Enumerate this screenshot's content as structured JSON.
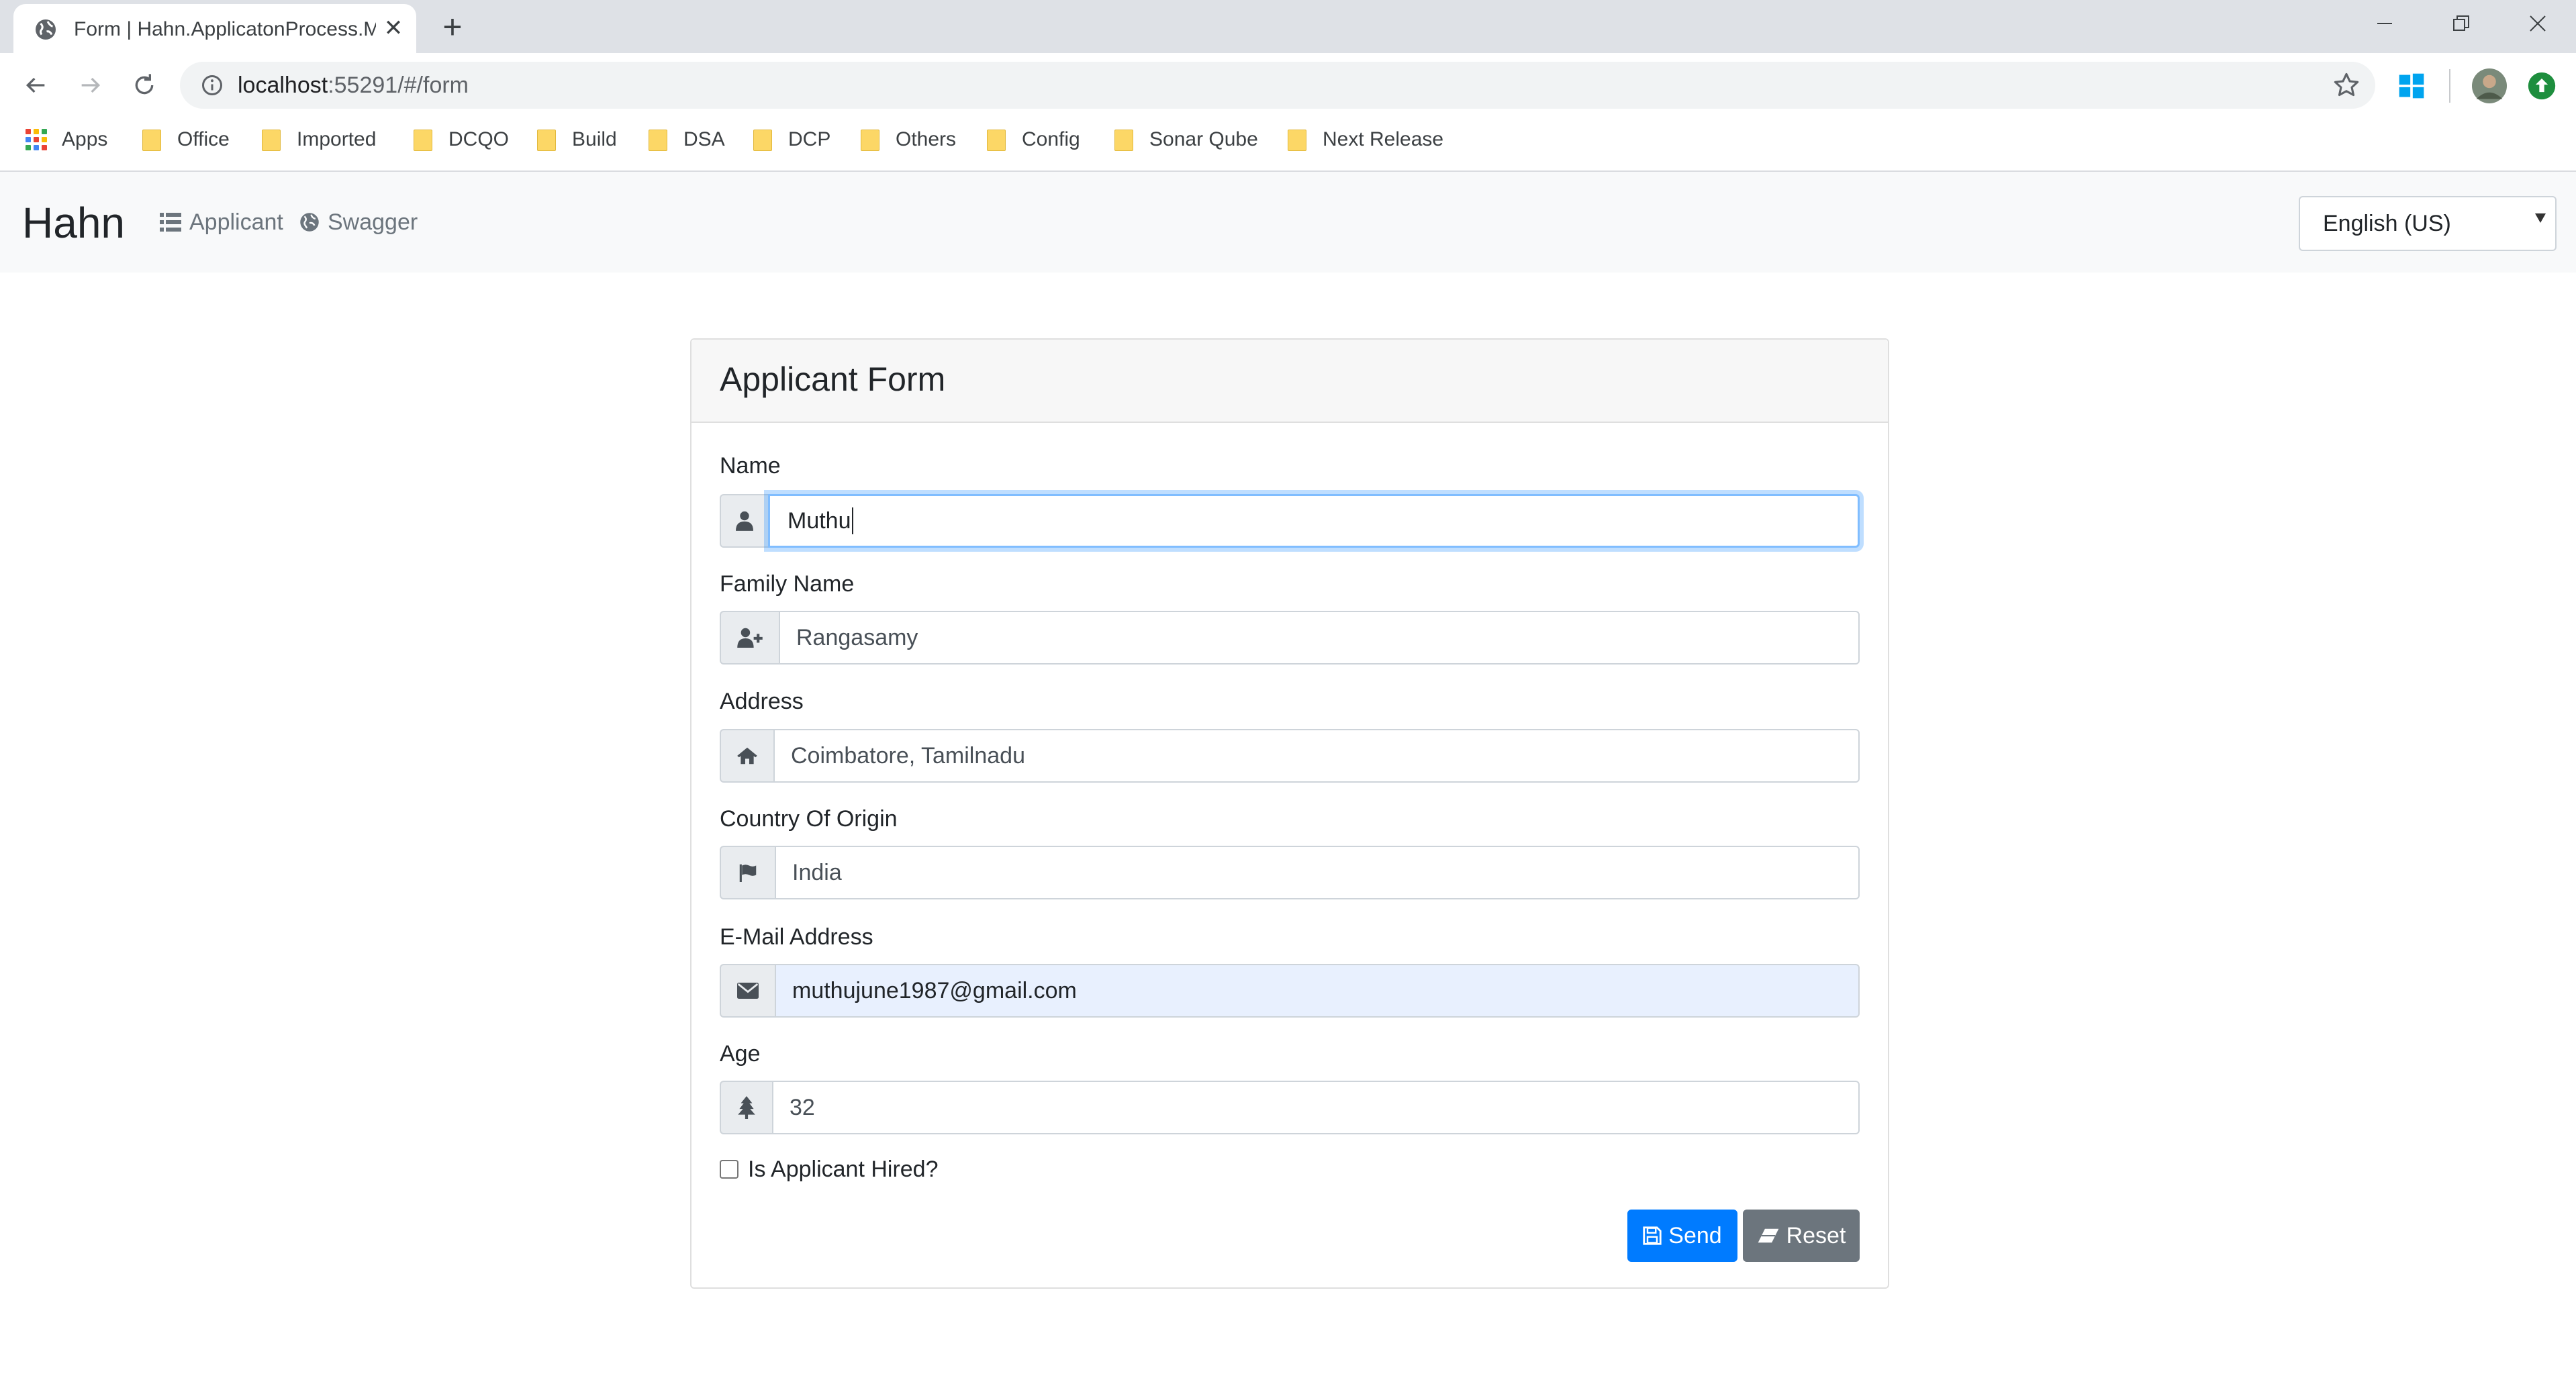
{
  "browser": {
    "tab_title": "Form | Hahn.ApplicatonProcess.M",
    "url_host": "localhost",
    "url_rest": ":55291/#/form",
    "bookmarks": [
      {
        "label": "Apps",
        "icon": "apps-grid-icon"
      },
      {
        "label": "Office",
        "icon": "folder-icon"
      },
      {
        "label": "Imported",
        "icon": "folder-icon"
      },
      {
        "label": "DCQO",
        "icon": "folder-icon"
      },
      {
        "label": "Build",
        "icon": "folder-icon"
      },
      {
        "label": "DSA",
        "icon": "folder-icon"
      },
      {
        "label": "DCP",
        "icon": "folder-icon"
      },
      {
        "label": "Others",
        "icon": "folder-icon"
      },
      {
        "label": "Config",
        "icon": "folder-icon"
      },
      {
        "label": "Sonar Qube",
        "icon": "folder-icon"
      },
      {
        "label": "Next Release",
        "icon": "folder-icon"
      }
    ]
  },
  "navbar": {
    "brand": "Hahn",
    "links": [
      {
        "label": "Applicant",
        "icon": "list-icon"
      },
      {
        "label": "Swagger",
        "icon": "globe-icon"
      }
    ],
    "language": "English (US)"
  },
  "form": {
    "title": "Applicant Form",
    "fields": [
      {
        "label": "Name",
        "value": "Muthu",
        "icon": "user-icon",
        "state": "focused"
      },
      {
        "label": "Family Name",
        "value": "Rangasamy",
        "icon": "user-plus-icon",
        "state": "normal"
      },
      {
        "label": "Address",
        "value": "Coimbatore, Tamilnadu",
        "icon": "home-icon",
        "state": "normal"
      },
      {
        "label": "Country Of Origin",
        "value": "India",
        "icon": "flag-icon",
        "state": "normal"
      },
      {
        "label": "E-Mail Address",
        "value": "muthujune1987@gmail.com",
        "icon": "envelope-icon",
        "state": "autofilled"
      },
      {
        "label": "Age",
        "value": "32",
        "icon": "tree-icon",
        "state": "normal"
      }
    ],
    "hired_label": "Is Applicant Hired?",
    "hired_checked": false,
    "send_label": "Send",
    "reset_label": "Reset"
  },
  "colors": {
    "primary": "#007bff",
    "secondary": "#6c757d",
    "navbar_bg": "#f8f9fa",
    "tabstrip_bg": "#dee1e6",
    "autofill_bg": "#e8f0fe",
    "focus_border": "#80bdff"
  }
}
